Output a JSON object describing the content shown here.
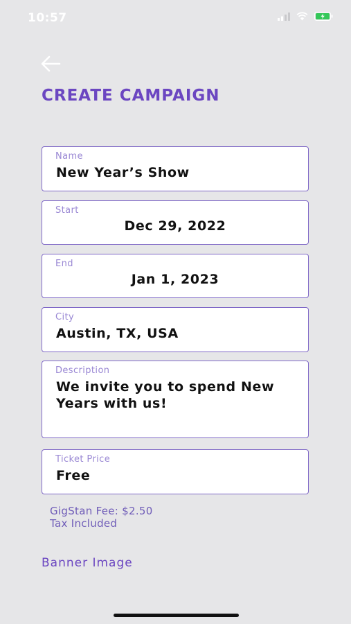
{
  "status_bar": {
    "time": "10:57"
  },
  "header": {
    "title": "CREATE CAMPAIGN"
  },
  "form": {
    "name": {
      "label": "Name",
      "value": "New Year’s Show"
    },
    "start": {
      "label": "Start",
      "value": "Dec 29, 2022"
    },
    "end": {
      "label": "End",
      "value": "Jan 1, 2023"
    },
    "city": {
      "label": "City",
      "value": "Austin, TX, USA"
    },
    "description": {
      "label": "Description",
      "value": "We invite you to spend New Years with us!"
    },
    "ticket_price": {
      "label": "Ticket Price",
      "value": "Free"
    }
  },
  "fee": {
    "line1": "GigStan Fee: $2.50",
    "line2": "Tax Included"
  },
  "banner": {
    "label": "Banner Image"
  },
  "colors": {
    "accent": "#6b46c1",
    "field_border": "#7e67c6",
    "background": "#e6e6e8"
  }
}
